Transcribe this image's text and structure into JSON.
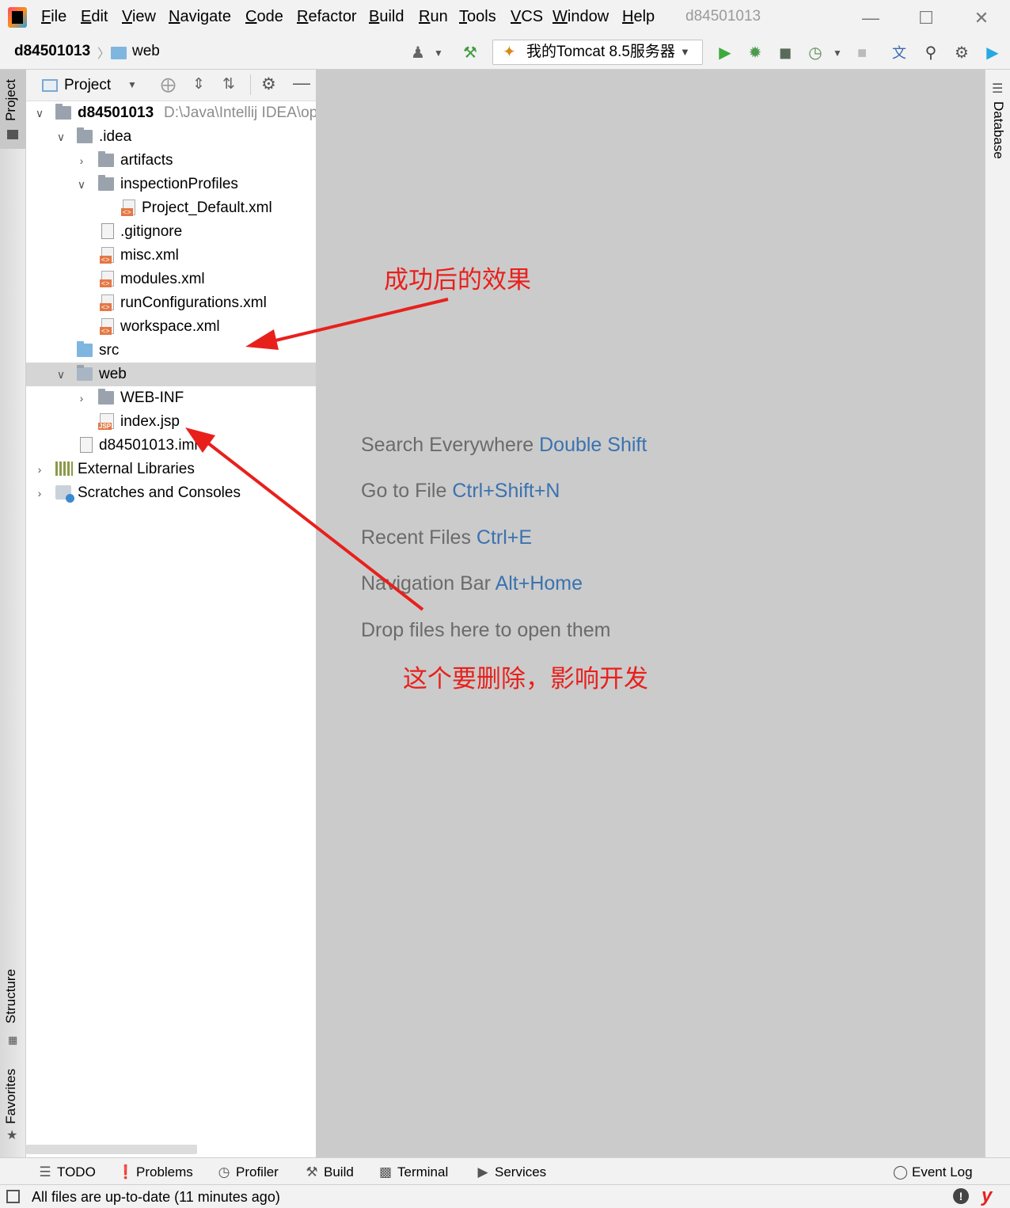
{
  "menu": {
    "items": [
      "File",
      "Edit",
      "View",
      "Navigate",
      "Code",
      "Refactor",
      "Build",
      "Run",
      "Tools",
      "VCS",
      "Window",
      "Help"
    ],
    "window_title": "d84501013"
  },
  "navbar": {
    "breadcrumb_project": "d84501013",
    "breadcrumb_folder": "web",
    "run_config": "我的Tomcat 8.5服务器"
  },
  "left_tabs": {
    "project": "Project",
    "structure": "Structure",
    "favorites": "Favorites"
  },
  "right_tabs": {
    "database": "Database"
  },
  "project_panel": {
    "view_label": "Project",
    "root_name": "d84501013",
    "root_path": "D:\\Java\\Intellij IDEA\\op",
    "tree": [
      {
        "label": "d84501013"
      },
      {
        "label": ".idea"
      },
      {
        "label": "artifacts"
      },
      {
        "label": "inspectionProfiles"
      },
      {
        "label": "Project_Default.xml"
      },
      {
        "label": ".gitignore"
      },
      {
        "label": "misc.xml"
      },
      {
        "label": "modules.xml"
      },
      {
        "label": "runConfigurations.xml"
      },
      {
        "label": "workspace.xml"
      },
      {
        "label": "src"
      },
      {
        "label": "web"
      },
      {
        "label": "WEB-INF"
      },
      {
        "label": "index.jsp"
      },
      {
        "label": "d84501013.iml"
      },
      {
        "label": "External Libraries"
      },
      {
        "label": "Scratches and Consoles"
      }
    ]
  },
  "editor": {
    "hints": [
      {
        "text": "Search Everywhere",
        "key": "Double Shift"
      },
      {
        "text": "Go to File",
        "key": "Ctrl+Shift+N"
      },
      {
        "text": "Recent Files",
        "key": "Ctrl+E"
      },
      {
        "text": "Navigation Bar",
        "key": "Alt+Home"
      },
      {
        "text": "Drop files here to open them",
        "key": ""
      }
    ],
    "annotation_top": "成功后的效果",
    "annotation_bottom": "这个要删除，影响开发"
  },
  "bottom_tabs": [
    "TODO",
    "Problems",
    "Profiler",
    "Build",
    "Terminal",
    "Services"
  ],
  "event_log": "Event Log",
  "status": "All files are up-to-date (11 minutes ago)",
  "colors": {
    "annotation": "#e8201c",
    "shortcut": "#3a72b0",
    "editor_bg": "#cbcbcb"
  }
}
